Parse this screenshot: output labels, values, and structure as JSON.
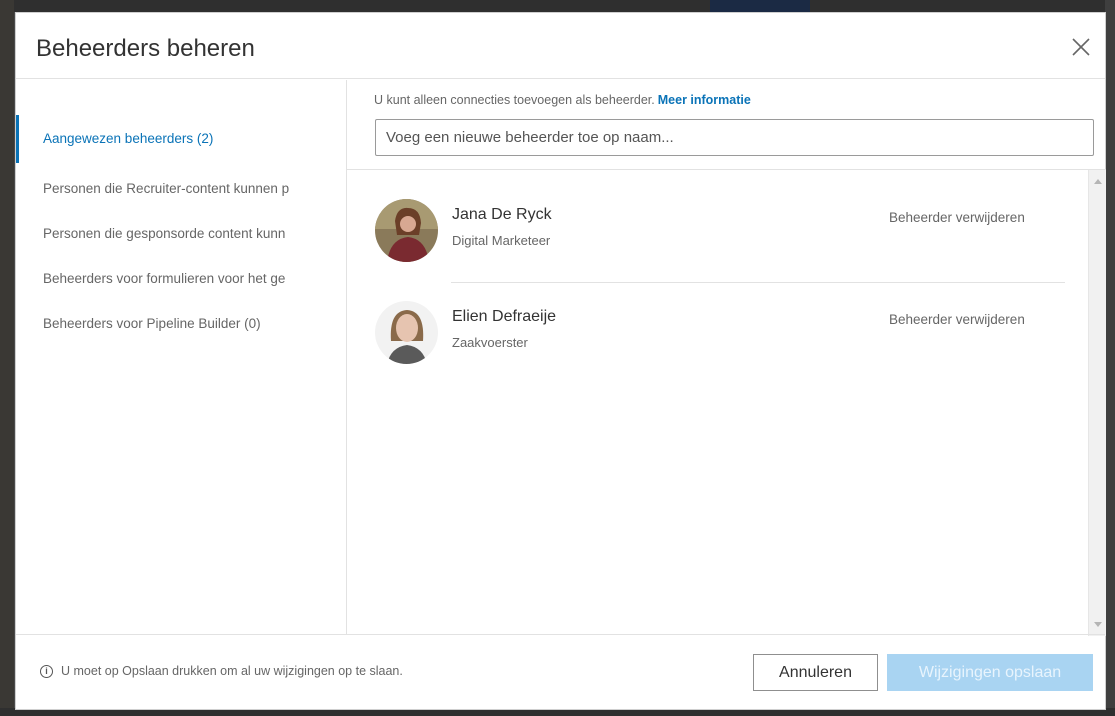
{
  "dialog": {
    "title": "Beheerders beheren",
    "close_icon": "close-icon"
  },
  "sidebar": {
    "items": [
      {
        "label": "Aangewezen beheerders (2)",
        "active": true
      },
      {
        "label": "Personen die Recruiter-content kunnen p",
        "active": false
      },
      {
        "label": "Personen die gesponsorde content kunn",
        "active": false
      },
      {
        "label": "Beheerders voor formulieren voor het ge",
        "active": false
      },
      {
        "label": "Beheerders voor Pipeline Builder (0)",
        "active": false
      }
    ]
  },
  "main": {
    "info_text": "U kunt alleen connecties toevoegen als beheerder.",
    "info_link": "Meer informatie",
    "search_placeholder": "Voeg een nieuwe beheerder toe op naam...",
    "admins": [
      {
        "name": "Jana De Ryck",
        "role": "Digital Marketeer",
        "remove_label": "Beheerder verwijderen"
      },
      {
        "name": "Elien Defraeije",
        "role": "Zaakvoerster",
        "remove_label": "Beheerder verwijderen"
      }
    ]
  },
  "footer": {
    "info_icon": "info-icon",
    "note": "U moet op Opslaan drukken om al uw wijzigingen op te slaan.",
    "cancel_label": "Annuleren",
    "save_label": "Wijzigingen opslaan"
  },
  "colors": {
    "accent": "#0a73b7",
    "save_disabled": "#a9d4f2"
  }
}
